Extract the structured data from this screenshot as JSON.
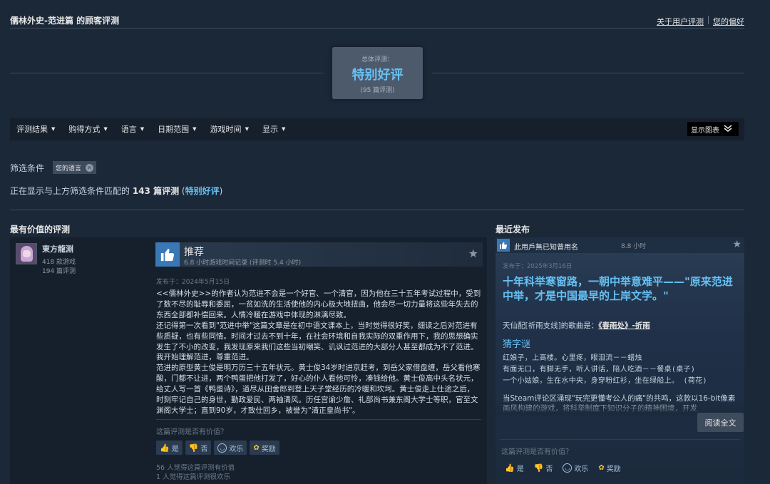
{
  "header": {
    "title": "儒林外史-范进篇 的顾客评测",
    "links": [
      "关于用户评测",
      "您的偏好"
    ]
  },
  "summary": {
    "label": "总体评测：",
    "rating": "特别好评",
    "count": "(95 篇评测)"
  },
  "filter_bar": {
    "items": [
      "评测结果",
      "购得方式",
      "语言",
      "日期范围",
      "游戏时间",
      "显示"
    ],
    "chart_button": "显示图表"
  },
  "active_filters": {
    "label": "筛选条件",
    "tag": "您的语言"
  },
  "showing": {
    "prefix": "正在显示与上方筛选条件匹配的",
    "count": "143 篇评测",
    "open": "(",
    "rating": "特别好评",
    "close": ")"
  },
  "sections": {
    "helpful_title": "最有价值的评测",
    "recent_title": "最近发布"
  },
  "review": {
    "author": "東方龍淵",
    "games": "418 款游戏",
    "reviews": "194 篇评测",
    "verdict": "推荐",
    "hours": "6.8 小时游戏时间记录 (评测时 5.4 小时)",
    "posted": "发布于：2024年5月15日",
    "body": [
      "<<儒林外史>>的作者认为范进不会是一个好官、一个清官，因为他在三十五年考试过程中，受到了数不尽的耻辱和委屈，一贫如洗的生活使他的内心极大地扭曲，他会尽一切力量将这些年失去的东西全部都补偿回来。人情冷暖在游戏中体现的淋漓尽致。",
      "还记得第一次看到\"范进中举\"这篇文章是在初中语文课本上，当时觉得很好笑，细读之后对范进有些质疑，也有些同情。时间才过去不到十年，在社会环境和自我实际的双重作用下，我的思想确实发生了不小的改变，我发现原来我们这些当初嘲笑、讥讽过范进的大部分人甚至都成为不了范进。我开始理解范进，尊重范进。",
      "范进的原型黄士俊是明万历三十五年状元。黄士俊34岁时进京赶考，到岳父家借盘缠，岳父看他寒酸，门都不让进，两个鸭蛋把他打发了，好心的仆人看他可怜，凑钱给他。黄士俊高中头名状元，给丈人写一首《鸭蛋诗》，道尽从田舍郎到登上天子堂经历的冷暖和坎坷。黄士俊走上仕途之后，时刻牢记自己的身世，勤政爱民、两袖清风。历任宫谕少詹、礼部尚书兼东阁大学士等职，官至文渊阁大学士；直到90岁，才致仕回乡，被誉为\"清正皇尚书\"。"
    ],
    "helpful_question": "这篇评测是否有价值？",
    "buttons": [
      "是",
      "否",
      "欢乐",
      "奖励"
    ],
    "helpful_stats": [
      "56 人觉得这篇评测有价值",
      "1 人觉得这篇评测很欢乐"
    ]
  },
  "recent": {
    "author": "此用戶無已知曾用名",
    "hours": "8.8 小时",
    "posted": "发布于：2025年3月16日",
    "headline": "十年科举寒窗路，一朝中举意难平——\"原来范进中举，才是中国最早的上岸文学。\"",
    "song_prefix": "天仙配[祈雨支线]的歌曲是：",
    "song": "《春雨处》-折雨",
    "subhead": "猜字谜",
    "riddle": [
      "红娘子，上高楼。心里疼，眼泪流－－蜡烛",
      "有面无口，有脚无手，听人讲话，陪人吃酒－－餐桌(桌子)",
      "一个小姑娘，生在水中央，身穿粉红衫，坐在绿船上。 (荷花)"
    ],
    "tail": "当Steam评论区涌现\"玩完更懂考公人的痛\"的共鸣，这款以16-bit像素画风构建的游戏，将科举制度下知识分子的精神困境，开发",
    "read_more": "阅读全文",
    "helpful_question": "这篇评测是否有价值？",
    "buttons": [
      "是",
      "否",
      "欢乐",
      "奖励"
    ]
  }
}
